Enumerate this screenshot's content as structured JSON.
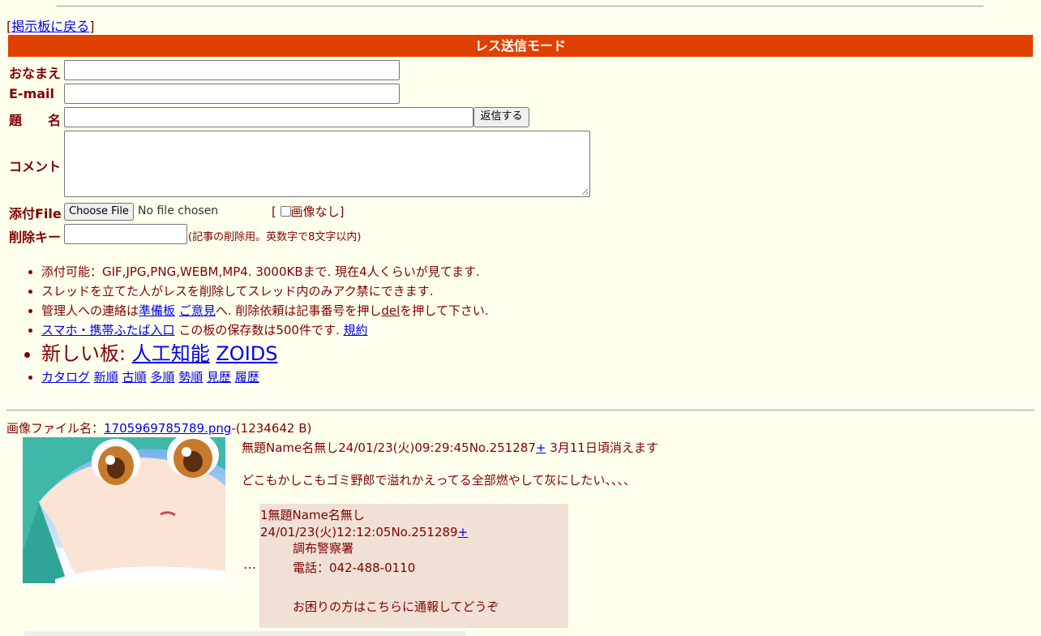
{
  "nav": {
    "back_bracket_open": "[",
    "back_link": "掲示板に戻る",
    "back_bracket_close": "]"
  },
  "mode_title": "レス送信モード",
  "form": {
    "name_label": "おなまえ",
    "email_label": "E-mail",
    "subject_label": "題　　名",
    "submit_label": "返信する",
    "comment_label": "コメント",
    "file_label": "添付File",
    "choose_file_label": "Choose File",
    "no_file_text": "No file chosen",
    "noimage_open": "[",
    "noimage_label": "画像なし",
    "noimage_close": "]",
    "delkey_label": "削除キー",
    "delkey_note": "(記事の削除用。英数字で8文字以内)"
  },
  "info": {
    "line1": "添付可能：GIF,JPG,PNG,WEBM,MP4. 3000KBまで. 現在4人くらいが見てます.",
    "line2": "スレッドを立てた人がレスを削除してスレッド内のみアク禁にできます.",
    "line3_pre": "管理人への連絡は",
    "line3_link1": "準備板",
    "line3_link2": "ご意見",
    "line3_mid": "へ. 削除依頼は記事番号を押し",
    "line3_del": "del",
    "line3_post": "を押して下さい.",
    "line4_link": "スマホ・携帯ふたば入口",
    "line4_mid": " この板の保存数は500件です. ",
    "line4_link2": "規約",
    "new_boards_label": "新しい板: ",
    "new_board1": "人工知能",
    "new_board2": "ZOIDS",
    "sort_links": [
      "カタログ",
      "新順",
      "古順",
      "多順",
      "勢順",
      "見歴",
      "履歴"
    ]
  },
  "post": {
    "file_label": "画像ファイル名：",
    "file_name": "1705969785789.png",
    "file_size": "-(1234642 B)",
    "header": "無題Name名無し24/01/23(火)09:29:45No.251287",
    "plus": "+",
    "expire": " 3月11日頃消えます",
    "body": "どこもかしこもゴミ野郎で溢れかえってる全部燃やして灰にしたい、、、、",
    "ellipsis": "…"
  },
  "reply": {
    "header": "1無題Name名無し 24/01/23(火)12:12:05No.251289",
    "plus": "+",
    "line1": "調布警察署",
    "line2": "電話：042-488-0110",
    "line3": "お困りの方はこちらに通報してどうぞ"
  }
}
